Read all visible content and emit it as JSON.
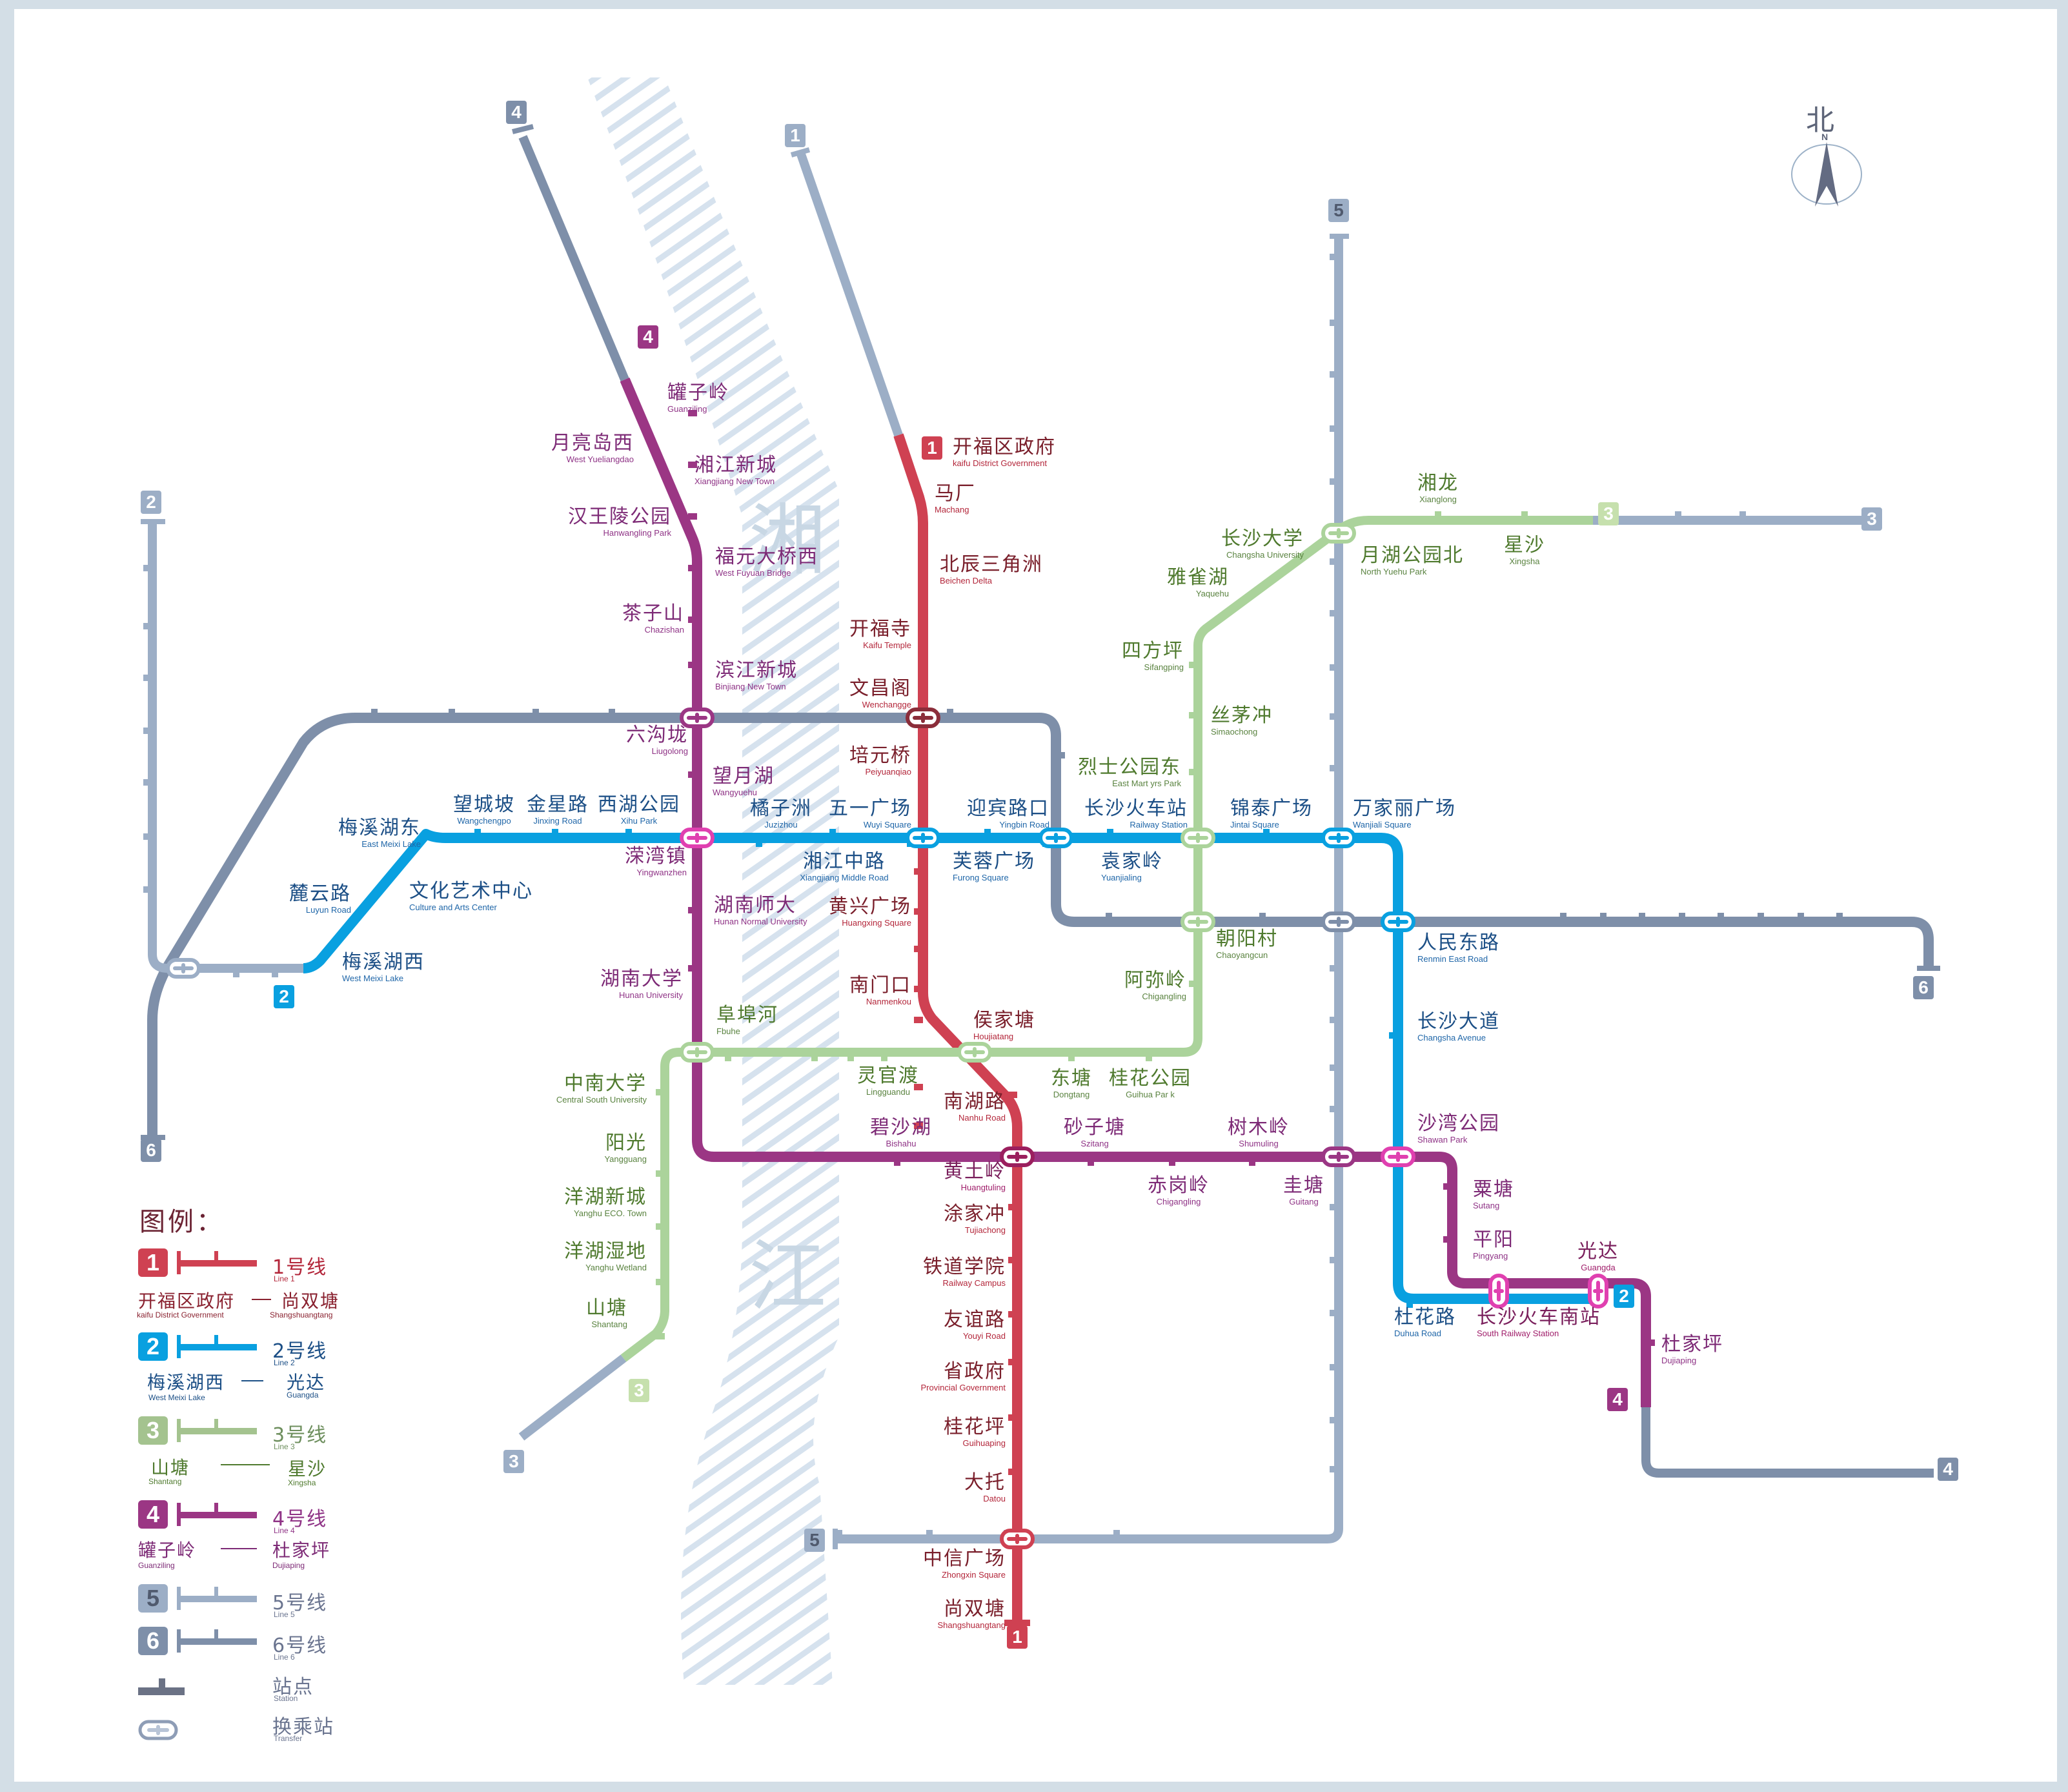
{
  "map": {
    "river_name": [
      "湘",
      "江"
    ],
    "compass": {
      "zh": "北",
      "en": "N"
    },
    "colors": {
      "line1": "#cf4152",
      "line2": "#09a0e0",
      "line3": "#abd39b",
      "line4": "#9b3684",
      "line5": "#9caec6",
      "line6": "#7e8fa9",
      "planned": "#9aaac3",
      "river": "#d6e2ee",
      "frame": "#d3dee6"
    }
  },
  "lines": [
    {
      "id": "1",
      "name_zh": "1号线",
      "name_en": "Line 1",
      "terminals": {
        "start_zh": "开福区政府",
        "start_en": "kaifu District Government",
        "end_zh": "尚双塘",
        "end_en": "Shangshuangtang"
      },
      "stations": [
        {
          "zh": "开福区政府",
          "en": "kaifu District Government"
        },
        {
          "zh": "马厂",
          "en": "Machang"
        },
        {
          "zh": "北辰三角洲",
          "en": "Beichen Delta"
        },
        {
          "zh": "开福寺",
          "en": "Kaifu Temple"
        },
        {
          "zh": "文昌阁",
          "en": "Wenchangge"
        },
        {
          "zh": "培元桥",
          "en": "Peiyuanqiao"
        },
        {
          "zh": "五一广场",
          "en": "Wuyi Square"
        },
        {
          "zh": "黄兴广场",
          "en": "Huangxing Square"
        },
        {
          "zh": "南门口",
          "en": "Nanmenkou"
        },
        {
          "zh": "侯家塘",
          "en": "Houjiatang"
        },
        {
          "zh": "南湖路",
          "en": "Nanhu Road"
        },
        {
          "zh": "黄土岭",
          "en": "Huangtuling"
        },
        {
          "zh": "涂家冲",
          "en": "Tujiachong"
        },
        {
          "zh": "铁道学院",
          "en": "Railway Campus"
        },
        {
          "zh": "友谊路",
          "en": "Youyi Road"
        },
        {
          "zh": "省政府",
          "en": "Provincial Government"
        },
        {
          "zh": "桂花坪",
          "en": "Guihuaping"
        },
        {
          "zh": "大托",
          "en": "Datou"
        },
        {
          "zh": "中信广场",
          "en": "Zhongxin Square"
        },
        {
          "zh": "尚双塘",
          "en": "Shangshuangtang"
        }
      ]
    },
    {
      "id": "2",
      "name_zh": "2号线",
      "name_en": "Line 2",
      "terminals": {
        "start_zh": "梅溪湖西",
        "start_en": "West Meixi Lake",
        "end_zh": "光达",
        "end_en": "Guangda"
      },
      "stations": [
        {
          "zh": "梅溪湖西",
          "en": "West Meixi Lake"
        },
        {
          "zh": "麓云路",
          "en": "Luyun Road"
        },
        {
          "zh": "文化艺术中心",
          "en": "Culture and Arts Center"
        },
        {
          "zh": "梅溪湖东",
          "en": "East Meixi Lake"
        },
        {
          "zh": "望城坡",
          "en": "Wangchengpo"
        },
        {
          "zh": "金星路",
          "en": "Jinxing Road"
        },
        {
          "zh": "西湖公园",
          "en": "Xihu Park"
        },
        {
          "zh": "溁湾镇",
          "en": "Yingwanzhen"
        },
        {
          "zh": "橘子洲",
          "en": "Juzizhou"
        },
        {
          "zh": "湘江中路",
          "en": "Xiangjiang Middle Road"
        },
        {
          "zh": "五一广场",
          "en": "Wuyi Square"
        },
        {
          "zh": "芙蓉广场",
          "en": "Furong Square"
        },
        {
          "zh": "迎宾路口",
          "en": "Yingbin Road"
        },
        {
          "zh": "袁家岭",
          "en": "Yuanjialing"
        },
        {
          "zh": "长沙火车站",
          "en": "Railway Station"
        },
        {
          "zh": "锦泰广场",
          "en": "Jintai Square"
        },
        {
          "zh": "万家丽广场",
          "en": "Wanjiali Square"
        },
        {
          "zh": "人民东路",
          "en": "Renmin East Road"
        },
        {
          "zh": "长沙大道",
          "en": "Changsha Avenue"
        },
        {
          "zh": "沙湾公园",
          "en": "Shawan Park"
        },
        {
          "zh": "杜花路",
          "en": "Duhua Road"
        },
        {
          "zh": "长沙火车南站",
          "en": "South Railway Station"
        },
        {
          "zh": "光达",
          "en": "Guangda"
        }
      ]
    },
    {
      "id": "3",
      "name_zh": "3号线",
      "name_en": "Line 3",
      "terminals": {
        "start_zh": "山塘",
        "start_en": "Shantang",
        "end_zh": "星沙",
        "end_en": "Xingsha"
      },
      "stations": [
        {
          "zh": "山塘",
          "en": "Shantang"
        },
        {
          "zh": "洋湖湿地",
          "en": "Yanghu Wetland"
        },
        {
          "zh": "洋湖新城",
          "en": "Yanghu ECO. Town"
        },
        {
          "zh": "阳光",
          "en": "Yangguang"
        },
        {
          "zh": "中南大学",
          "en": "Central South University"
        },
        {
          "zh": "阜埠河",
          "en": "Fbuhe"
        },
        {
          "zh": "灵官渡",
          "en": "Lingguandu"
        },
        {
          "zh": "侯家塘",
          "en": "Houjiatang"
        },
        {
          "zh": "东塘",
          "en": "Dongtang"
        },
        {
          "zh": "桂花公园",
          "en": "Guihua Par k"
        },
        {
          "zh": "阿弥岭",
          "en": "Chigangling"
        },
        {
          "zh": "朝阳村",
          "en": "Chaoyangcun"
        },
        {
          "zh": "长沙火车站",
          "en": "Railway Station"
        },
        {
          "zh": "烈士公园东",
          "en": "East Mart yrs Park"
        },
        {
          "zh": "丝茅冲",
          "en": "Simaochong"
        },
        {
          "zh": "四方坪",
          "en": "Sifangping"
        },
        {
          "zh": "雅雀湖",
          "en": "Yaquehu"
        },
        {
          "zh": "长沙大学",
          "en": "Changsha University"
        },
        {
          "zh": "月湖公园北",
          "en": "North Yuehu Park"
        },
        {
          "zh": "湘龙",
          "en": "Xianglong"
        },
        {
          "zh": "星沙",
          "en": "Xingsha"
        }
      ]
    },
    {
      "id": "4",
      "name_zh": "4号线",
      "name_en": "Line 4",
      "terminals": {
        "start_zh": "罐子岭",
        "start_en": "Guanziling",
        "end_zh": "杜家坪",
        "end_en": "Dujiaping"
      },
      "stations": [
        {
          "zh": "罐子岭",
          "en": "Guanziling"
        },
        {
          "zh": "月亮岛西",
          "en": "West Yueliangdao"
        },
        {
          "zh": "湘江新城",
          "en": "Xiangjiang New Town"
        },
        {
          "zh": "汉王陵公园",
          "en": "Hanwangling Park"
        },
        {
          "zh": "福元大桥西",
          "en": "West Fuyuan Bridge"
        },
        {
          "zh": "茶子山",
          "en": "Chazishan"
        },
        {
          "zh": "滨江新城",
          "en": "Binjiang New Town"
        },
        {
          "zh": "六沟垅",
          "en": "Liugolong"
        },
        {
          "zh": "望月湖",
          "en": "Wangyuehu"
        },
        {
          "zh": "溁湾镇",
          "en": "Yingwanzhen"
        },
        {
          "zh": "湖南师大",
          "en": "Hunan Normal  University"
        },
        {
          "zh": "湖南大学",
          "en": "Hunan  University"
        },
        {
          "zh": "阜埠河",
          "en": "Fbuhe"
        },
        {
          "zh": "碧沙湖",
          "en": "Bishahu"
        },
        {
          "zh": "黄土岭",
          "en": "Huangtuling"
        },
        {
          "zh": "砂子塘",
          "en": "Szitang"
        },
        {
          "zh": "赤岗岭",
          "en": "Chigangling"
        },
        {
          "zh": "树木岭",
          "en": "Shumuling"
        },
        {
          "zh": "圭塘",
          "en": "Guitang"
        },
        {
          "zh": "沙湾公园",
          "en": "Shawan Park"
        },
        {
          "zh": "粟塘",
          "en": "Sutang"
        },
        {
          "zh": "平阳",
          "en": "Pingyang"
        },
        {
          "zh": "长沙火车南站",
          "en": "South Railway Station"
        },
        {
          "zh": "光达",
          "en": "Guangda"
        },
        {
          "zh": "杜家坪",
          "en": "Dujiaping"
        }
      ]
    },
    {
      "id": "5",
      "name_zh": "5号线",
      "name_en": "Line 5"
    },
    {
      "id": "6",
      "name_zh": "6号线",
      "name_en": "Line 6"
    }
  ],
  "legend": {
    "title": "图例：",
    "station_zh": "站点",
    "station_en": "Station",
    "transfer_zh": "换乘站",
    "transfer_en": "Transfer"
  }
}
